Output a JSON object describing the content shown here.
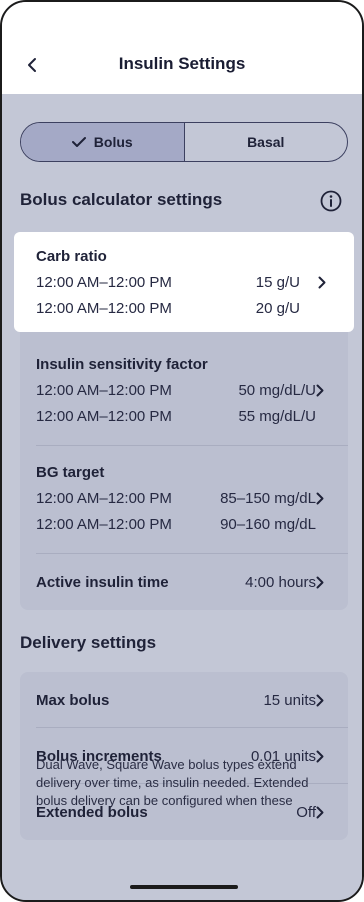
{
  "header": {
    "title": "Insulin Settings"
  },
  "segmented": {
    "bolus_label": "Bolus",
    "basal_label": "Basal"
  },
  "bolus_section": {
    "title": "Bolus calculator settings",
    "carb_ratio": {
      "title": "Carb ratio",
      "rows": [
        {
          "time": "12:00 AM–12:00 PM",
          "value": "15 g/U"
        },
        {
          "time": "12:00 AM–12:00 PM",
          "value": "20 g/U"
        }
      ]
    },
    "isf": {
      "title": "Insulin sensitivity factor",
      "rows": [
        {
          "time": "12:00 AM–12:00 PM",
          "value": "50 mg/dL/U"
        },
        {
          "time": "12:00 AM–12:00 PM",
          "value": "55 mg/dL/U"
        }
      ]
    },
    "bg_target": {
      "title": "BG target",
      "rows": [
        {
          "time": "12:00 AM–12:00 PM",
          "value": "85–150 mg/dL"
        },
        {
          "time": "12:00 AM–12:00 PM",
          "value": "90–160 mg/dL"
        }
      ]
    },
    "active_insulin": {
      "label": "Active insulin time",
      "value": "4:00 hours"
    }
  },
  "delivery_section": {
    "title": "Delivery settings",
    "max_bolus": {
      "label": "Max bolus",
      "value": "15 units"
    },
    "bolus_increments": {
      "label": "Bolus increments",
      "value": "0.01 units"
    },
    "extended_bolus": {
      "label": "Extended bolus",
      "value": "Off"
    },
    "note": "Dual Wave, Square Wave bolus types extend delivery over time, as insulin needed. Extended bolus delivery can be configured when these"
  }
}
